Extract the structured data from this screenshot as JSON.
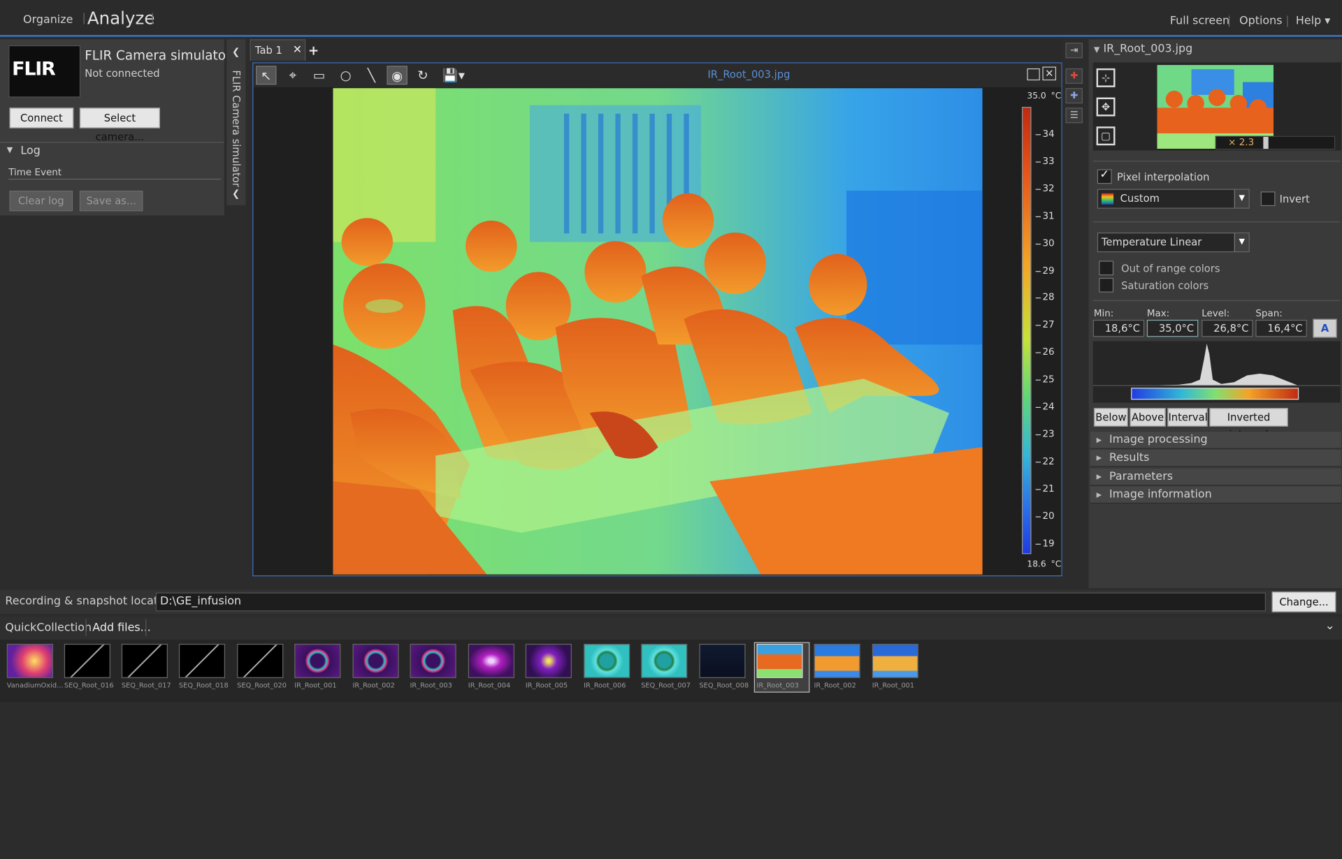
{
  "topbar": {
    "organize": "Organize",
    "analyze": "Analyze",
    "fullscreen": "Full screen",
    "options": "Options",
    "help": "Help ▾"
  },
  "camera": {
    "logo": "FLIR",
    "title": "FLIR Camera simulator",
    "status": "Not connected",
    "connect": "Connect",
    "select": "Select camera...",
    "vertical_title": "FLIR Camera simulator"
  },
  "log": {
    "header": "Log",
    "columns": "Time Event",
    "clear": "Clear log",
    "save": "Save as..."
  },
  "tabs": [
    {
      "label": "Tab 1"
    }
  ],
  "viewer": {
    "filename": "IR_Root_003.jpg"
  },
  "scale": {
    "top": "35.0",
    "bottom": "18.6",
    "unit": "°C",
    "ticks": [
      "34",
      "33",
      "32",
      "31",
      "30",
      "29",
      "28",
      "27",
      "26",
      "25",
      "24",
      "23",
      "22",
      "21",
      "20",
      "19"
    ]
  },
  "panel": {
    "file": "IR_Root_003.jpg",
    "zoom": "× 2.3",
    "pixel_interp": "Pixel interpolation",
    "palette": "Custom",
    "invert": "Invert",
    "scale_mode": "Temperature Linear",
    "out_of_range": "Out of range colors",
    "saturation": "Saturation colors",
    "labels": {
      "min": "Min:",
      "max": "Max:",
      "level": "Level:",
      "span": "Span:"
    },
    "values": {
      "min": "18,6°C",
      "max": "35,0°C",
      "level": "26,8°C",
      "span": "16,4°C"
    },
    "buttons": [
      "Below",
      "Above",
      "Interval",
      "Inverted interval"
    ],
    "sections": [
      "Image processing",
      "Results",
      "Parameters",
      "Image information"
    ]
  },
  "recording": {
    "label": "Recording & snapshot location:",
    "path": "D:\\GE_infusion",
    "change": "Change..."
  },
  "quick": {
    "label": "QuickCollection",
    "add": "Add files..."
  },
  "thumbnails": [
    {
      "name": "VanadiumOxid...",
      "kind": "vanadium"
    },
    {
      "name": "SEQ_Root_016",
      "kind": "seq"
    },
    {
      "name": "SEQ_Root_017",
      "kind": "seq"
    },
    {
      "name": "SEQ_Root_018",
      "kind": "seq"
    },
    {
      "name": "SEQ_Root_020",
      "kind": "seq"
    },
    {
      "name": "IR_Root_001",
      "kind": "ring"
    },
    {
      "name": "IR_Root_002",
      "kind": "ring"
    },
    {
      "name": "IR_Root_003",
      "kind": "ring"
    },
    {
      "name": "IR_Root_004",
      "kind": "disc"
    },
    {
      "name": "IR_Root_005",
      "kind": "disc2"
    },
    {
      "name": "IR_Root_006",
      "kind": "teal"
    },
    {
      "name": "SEQ_Root_007",
      "kind": "teal"
    },
    {
      "name": "SEQ_Root_008",
      "kind": "dark"
    },
    {
      "name": "IR_Root_003",
      "kind": "people",
      "selected": true
    },
    {
      "name": "IR_Root_002",
      "kind": "people2"
    },
    {
      "name": "IR_Root_001",
      "kind": "people3"
    }
  ],
  "colors": {
    "accent": "#3c76c7"
  }
}
